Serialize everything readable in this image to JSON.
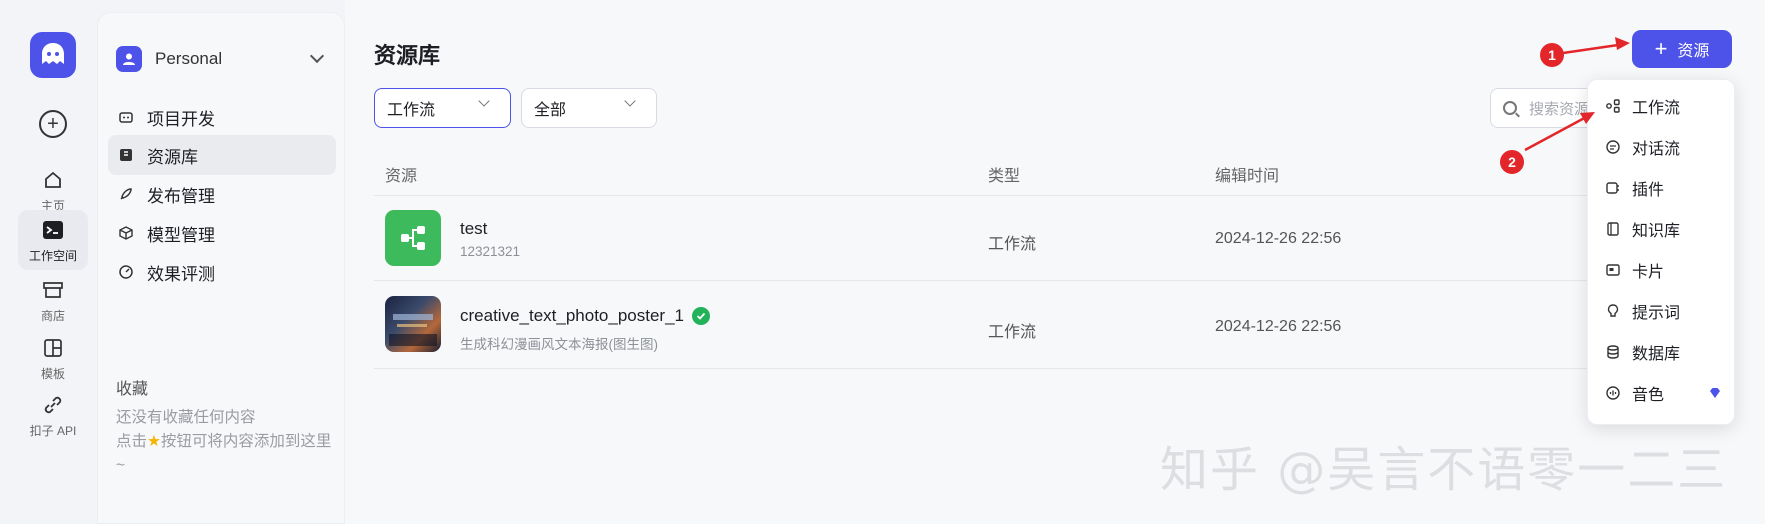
{
  "rail": {
    "items": [
      {
        "label": "主页"
      },
      {
        "label": "工作空间"
      },
      {
        "label": "商店"
      },
      {
        "label": "模板"
      },
      {
        "label": "扣子 API"
      }
    ]
  },
  "sidebar": {
    "space_name": "Personal",
    "nav": [
      {
        "label": "项目开发"
      },
      {
        "label": "资源库"
      },
      {
        "label": "发布管理"
      },
      {
        "label": "模型管理"
      },
      {
        "label": "效果评测"
      }
    ],
    "favorites_title": "收藏",
    "favorites_hint_1": "还没有收藏任何内容",
    "favorites_hint_2": "点击",
    "favorites_hint_3": "按钮可将内容添加到这里~"
  },
  "main": {
    "title": "资源库",
    "add_button": "资源",
    "filter_type": "工作流",
    "filter_scope": "全部",
    "search_placeholder": "搜索资源",
    "columns": {
      "resource": "资源",
      "type": "类型",
      "edit_time": "编辑时间"
    },
    "rows": [
      {
        "name": "test",
        "desc": "12321321",
        "type": "工作流",
        "time": "2024-12-26 22:56"
      },
      {
        "name": "creative_text_photo_poster_1",
        "desc": "生成科幻漫画风文本海报(图生图)",
        "type": "工作流",
        "time": "2024-12-26 22:56"
      }
    ]
  },
  "menu": {
    "items": [
      {
        "label": "工作流",
        "icon": "workflow-icon"
      },
      {
        "label": "对话流",
        "icon": "chatflow-icon"
      },
      {
        "label": "插件",
        "icon": "plugin-icon"
      },
      {
        "label": "知识库",
        "icon": "knowledge-icon"
      },
      {
        "label": "卡片",
        "icon": "card-icon"
      },
      {
        "label": "提示词",
        "icon": "prompt-icon"
      },
      {
        "label": "数据库",
        "icon": "database-icon"
      },
      {
        "label": "音色",
        "icon": "voice-icon"
      }
    ]
  },
  "annotations": {
    "step1": "1",
    "step2": "2"
  },
  "watermark": "知乎 @吴言不语零一二三",
  "colors": {
    "accent": "#4d53e8",
    "verified": "#21b25a",
    "annotation": "#e2262a"
  }
}
